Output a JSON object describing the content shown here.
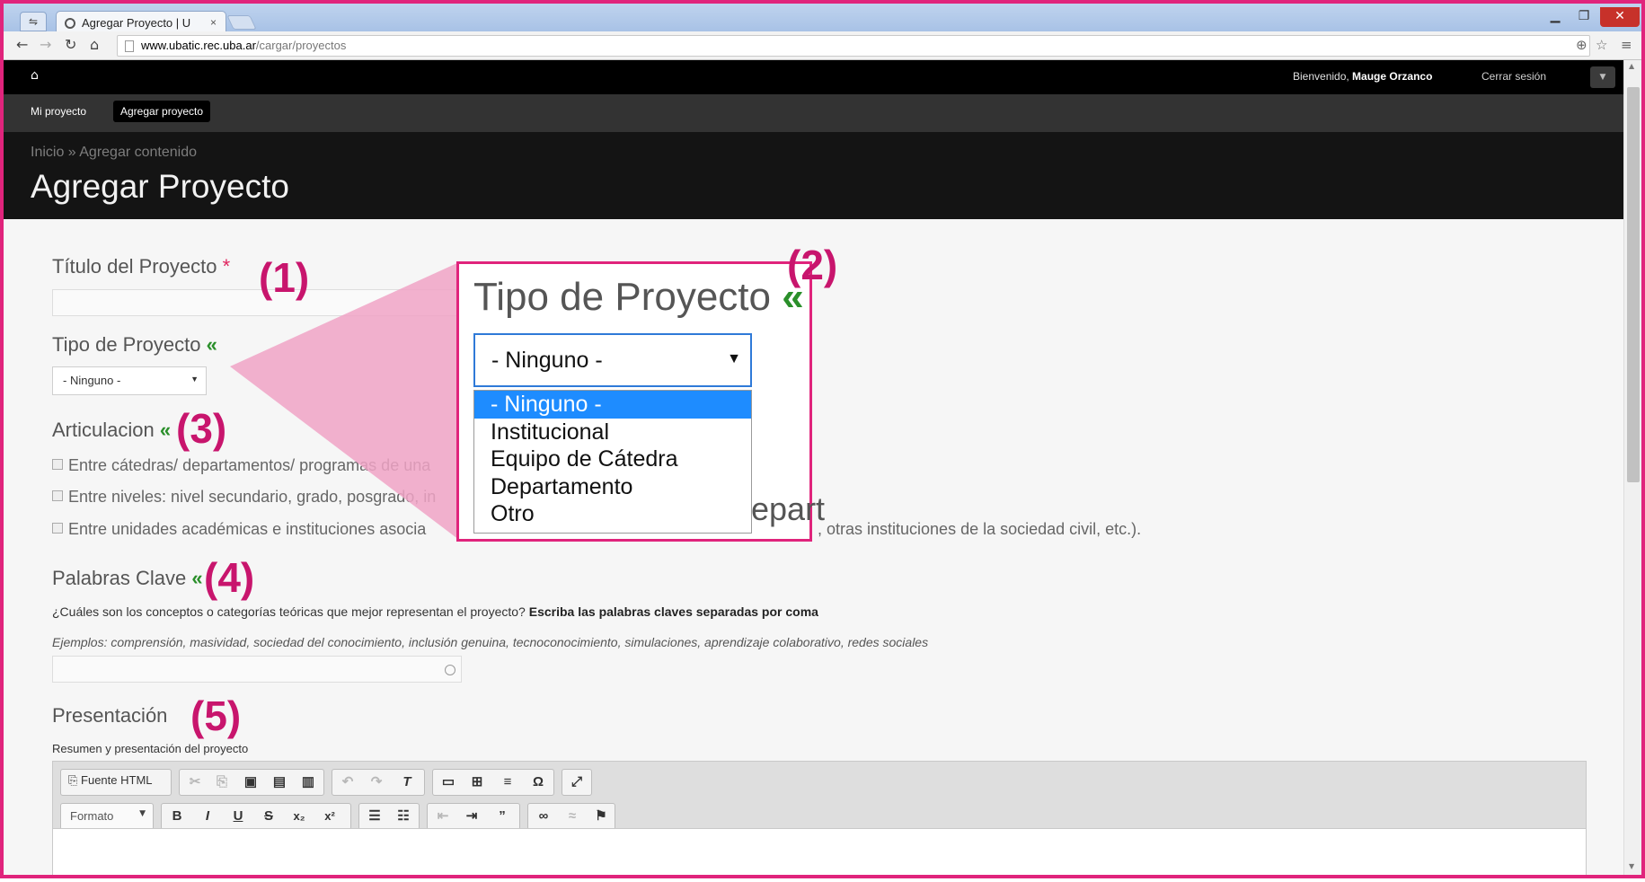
{
  "browser": {
    "tab_title": "Agregar Proyecto | U",
    "url_host": "www.ubatic.rec.uba.ar",
    "url_path": "/cargar/proyectos"
  },
  "site": {
    "welcome_prefix": "Bienvenido, ",
    "user_name": "Mauge Orzanco",
    "logout": "Cerrar sesión",
    "nav": [
      "Mi proyecto",
      "Agregar proyecto"
    ],
    "breadcrumb": "Inicio » Agregar contenido",
    "page_title": "Agregar Proyecto"
  },
  "form": {
    "titulo_label": "Título del Proyecto",
    "required_mark": "*",
    "tipo_label": "Tipo de Proyecto",
    "green_mark": "«",
    "tipo_selected": "- Ninguno -",
    "articulacion_label": "Articulacion",
    "articulacion_options": [
      "Entre cátedras/ departamentos/ programas de una",
      "Entre niveles: nivel secundario, grado, posgrado, in",
      "Entre unidades académicas e instituciones asocia"
    ],
    "articulacion_tail": ", otras instituciones de la sociedad civil, etc.).",
    "palabras_label": "Palabras Clave",
    "palabras_help_plain": "¿Cuáles son los conceptos o categorías teóricas que mejor representan el proyecto? ",
    "palabras_help_bold": "Escriba las palabras claves separadas por coma",
    "palabras_example": "Ejemplos: comprensión, masividad, sociedad del conocimiento, inclusión genuina, tecnoconocimiento, simulaciones, aprendizaje colaborativo, redes sociales",
    "presentacion_label": "Presentación",
    "presentacion_help": "Resumen y presentación del proyecto"
  },
  "editor": {
    "source_label": "Fuente HTML",
    "format_label": "Formato"
  },
  "annotations": [
    "(1)",
    "(2)",
    "(3)",
    "(4)",
    "(5)"
  ],
  "callout": {
    "title": "Tipo de Proyecto",
    "selected": "- Ninguno -",
    "options": [
      "- Ninguno -",
      "Institucional",
      "Equipo de Cátedra",
      "Departamento",
      "Otro"
    ],
    "ghost_text": "epart"
  },
  "colors": {
    "accent_pink": "#e0247c",
    "annotation": "#c8156d",
    "selected_option": "#1e8cff",
    "green_mark": "#2a8f2a"
  }
}
